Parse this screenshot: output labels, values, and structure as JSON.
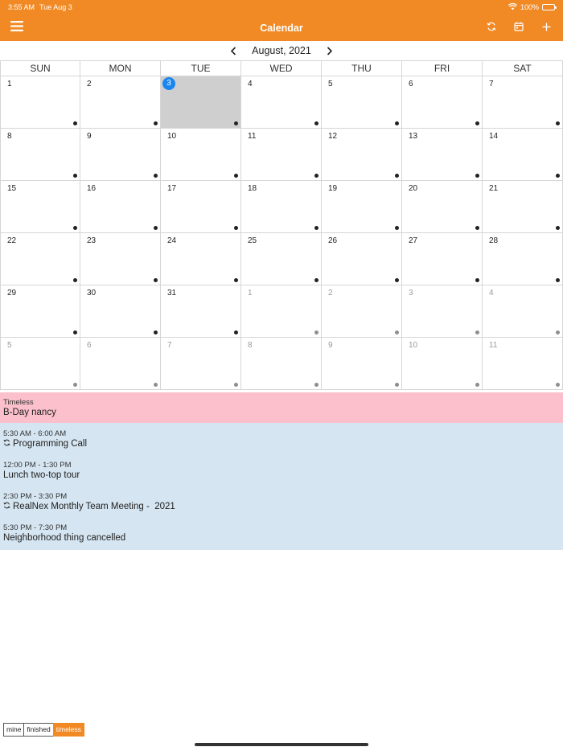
{
  "status_bar": {
    "time": "3:55 AM",
    "date": "Tue Aug 3",
    "battery": "100%"
  },
  "nav": {
    "title": "Calendar",
    "menu_icon": "hamburger-icon",
    "sync_icon": "sync-icon",
    "today_icon": "calendar-icon",
    "add_icon": "plus-icon"
  },
  "month": {
    "label": "August, 2021"
  },
  "weekdays": [
    "SUN",
    "MON",
    "TUE",
    "WED",
    "THU",
    "FRI",
    "SAT"
  ],
  "days": [
    {
      "n": "1",
      "other": false
    },
    {
      "n": "2",
      "other": false
    },
    {
      "n": "3",
      "other": false,
      "today": true,
      "selected": true
    },
    {
      "n": "4",
      "other": false
    },
    {
      "n": "5",
      "other": false
    },
    {
      "n": "6",
      "other": false
    },
    {
      "n": "7",
      "other": false
    },
    {
      "n": "8",
      "other": false
    },
    {
      "n": "9",
      "other": false
    },
    {
      "n": "10",
      "other": false
    },
    {
      "n": "11",
      "other": false
    },
    {
      "n": "12",
      "other": false
    },
    {
      "n": "13",
      "other": false
    },
    {
      "n": "14",
      "other": false
    },
    {
      "n": "15",
      "other": false
    },
    {
      "n": "16",
      "other": false
    },
    {
      "n": "17",
      "other": false
    },
    {
      "n": "18",
      "other": false
    },
    {
      "n": "19",
      "other": false
    },
    {
      "n": "20",
      "other": false
    },
    {
      "n": "21",
      "other": false
    },
    {
      "n": "22",
      "other": false
    },
    {
      "n": "23",
      "other": false
    },
    {
      "n": "24",
      "other": false
    },
    {
      "n": "25",
      "other": false
    },
    {
      "n": "26",
      "other": false
    },
    {
      "n": "27",
      "other": false
    },
    {
      "n": "28",
      "other": false
    },
    {
      "n": "29",
      "other": false
    },
    {
      "n": "30",
      "other": false
    },
    {
      "n": "31",
      "other": false
    },
    {
      "n": "1",
      "other": true
    },
    {
      "n": "2",
      "other": true
    },
    {
      "n": "3",
      "other": true
    },
    {
      "n": "4",
      "other": true
    },
    {
      "n": "5",
      "other": true
    },
    {
      "n": "6",
      "other": true
    },
    {
      "n": "7",
      "other": true
    },
    {
      "n": "8",
      "other": true
    },
    {
      "n": "9",
      "other": true
    },
    {
      "n": "10",
      "other": true
    },
    {
      "n": "11",
      "other": true
    }
  ],
  "timeless": {
    "label": "Timeless",
    "title": "B-Day nancy"
  },
  "events": [
    {
      "time": "5:30 AM - 6:00 AM",
      "title": "Programming Call",
      "recurring": true
    },
    {
      "time": "12:00 PM - 1:30 PM",
      "title": "Lunch two-top tour",
      "recurring": false
    },
    {
      "time": "2:30 PM - 3:30 PM",
      "title": "RealNex Monthly Team Meeting -  2021",
      "recurring": true
    },
    {
      "time": "5:30 PM - 7:30 PM",
      "title": "Neighborhood thing cancelled",
      "recurring": false
    }
  ],
  "legend": [
    {
      "label": "mine",
      "active": false
    },
    {
      "label": "finished",
      "active": false
    },
    {
      "label": "timeless",
      "active": true
    }
  ],
  "colors": {
    "accent": "#f18a25",
    "today": "#1a86f0",
    "timeless_bg": "#fbc0cb",
    "events_bg": "#d5e5f1",
    "selected_bg": "#cfcfcf"
  }
}
